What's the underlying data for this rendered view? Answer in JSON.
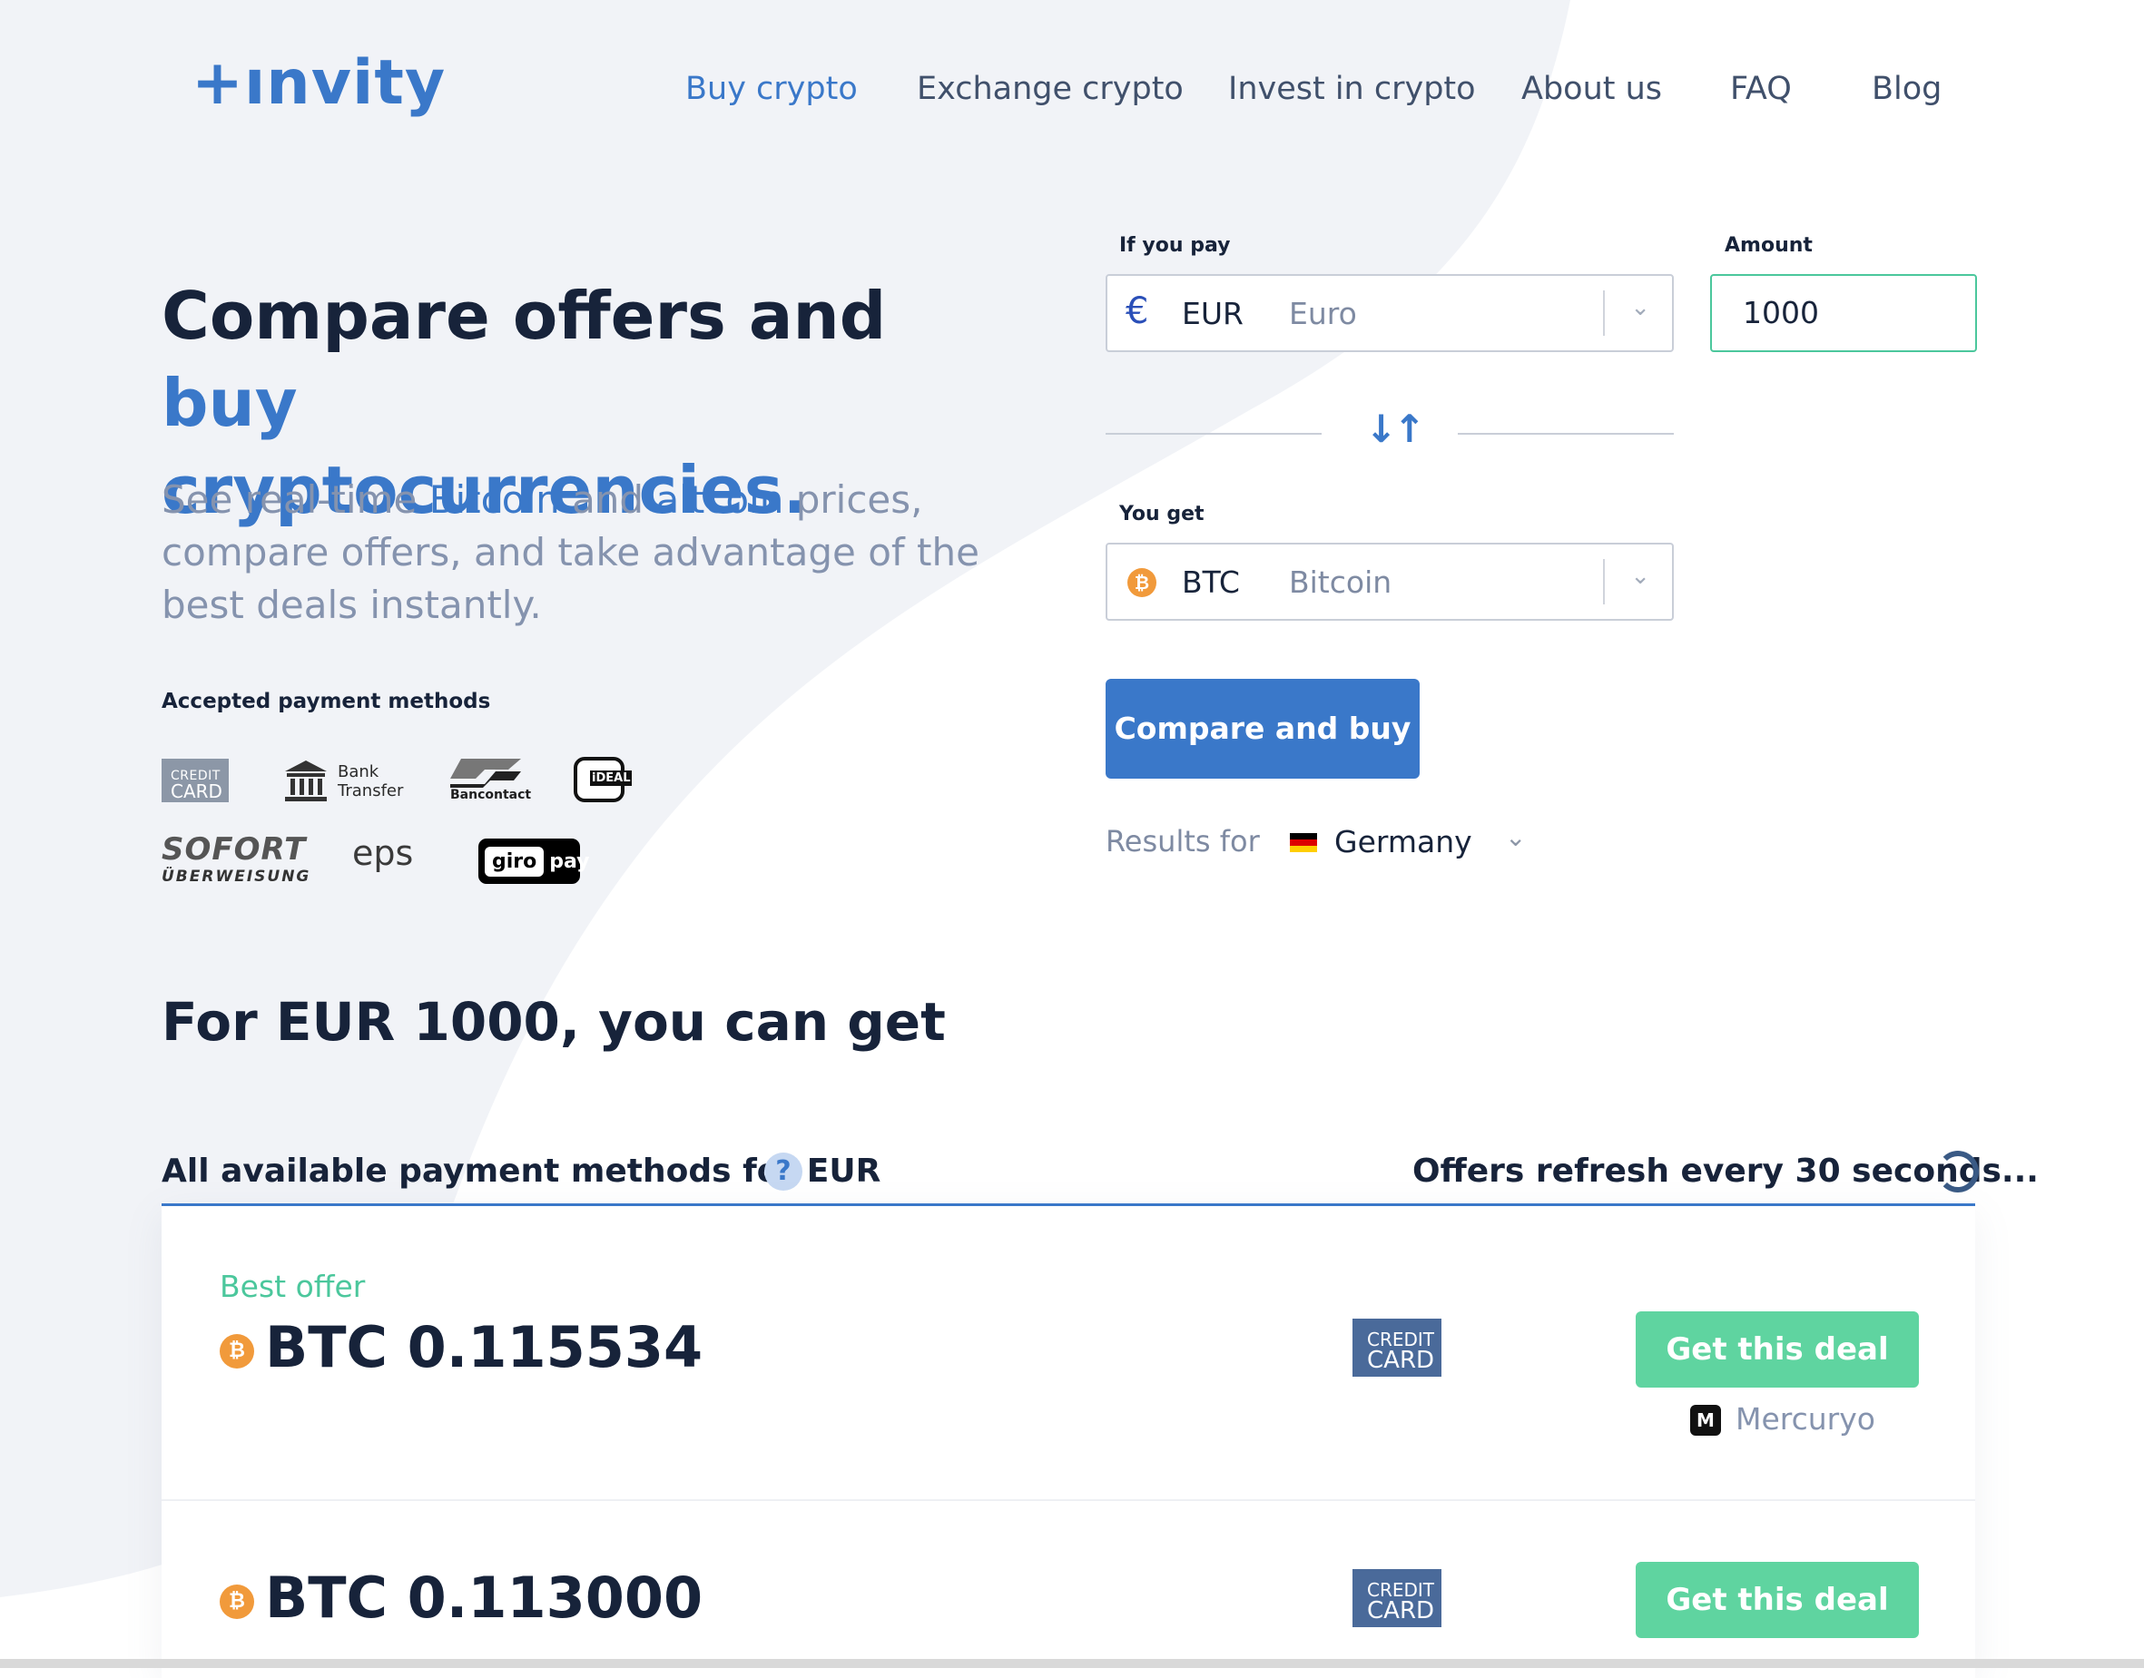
{
  "brand": {
    "logo": "+ınvity"
  },
  "nav": {
    "items": [
      {
        "label": "Buy crypto"
      },
      {
        "label": "Exchange crypto"
      },
      {
        "label": "Invest in crypto"
      },
      {
        "label": "About us"
      },
      {
        "label": "FAQ"
      },
      {
        "label": "Blog"
      }
    ]
  },
  "hero": {
    "title_part1": "Compare offers and ",
    "title_accent": "buy",
    "title_part2": "cryptocurrencies.",
    "subtitle_a": "See real-time ",
    "subtitle_link1": "Bitcoin",
    "subtitle_b": " and ",
    "subtitle_link2": "altcoin",
    "subtitle_c": " prices, compare offers, and take advantage of the best deals instantly."
  },
  "payment_methods": {
    "title": "Accepted payment methods",
    "credit_card": {
      "line1": "CREDIT",
      "line2": "CARD"
    },
    "bank": {
      "line1": "Bank",
      "line2": "Transfer"
    },
    "bancontact": "Bancontact",
    "ideal": "iDEAL",
    "sofort": {
      "line1": "SOFORT",
      "line2": "ÜBERWEISUNG"
    },
    "eps": "eps",
    "giropay": {
      "part1": "giro",
      "part2": "pay"
    }
  },
  "form": {
    "pay_label": "If you pay",
    "pay_code": "EUR",
    "pay_name": "Euro",
    "pay_symbol": "€",
    "amount_label": "Amount",
    "amount_value": "1000",
    "get_label": "You get",
    "get_code": "BTC",
    "get_name": "Bitcoin",
    "coin_symbol": "₿",
    "chevron": "⌄",
    "swap_icon": "↓↑",
    "cta": "Compare and buy",
    "results_for_label": "Results for",
    "country": "Germany"
  },
  "results": {
    "title": "For EUR 1000, you can get",
    "methods_header": "All available payment methods for EUR",
    "help": "?",
    "refresh_text": "Offers refresh every 30 seconds...",
    "offers": [
      {
        "tag": "Best offer",
        "amount": "BTC 0.115534",
        "method": {
          "line1": "CREDIT",
          "line2": "CARD"
        },
        "button": "Get this deal",
        "provider": "Mercuryo",
        "provider_icon": "M"
      },
      {
        "amount": "BTC 0.113000",
        "method": {
          "line1": "CREDIT",
          "line2": "CARD"
        },
        "button": "Get this deal"
      }
    ]
  },
  "colors": {
    "accent": "#3a78c9",
    "success": "#5fd4a0",
    "text_dark": "#17233a",
    "text_muted": "#8593ae",
    "bg_shape": "#f1f3f7"
  }
}
